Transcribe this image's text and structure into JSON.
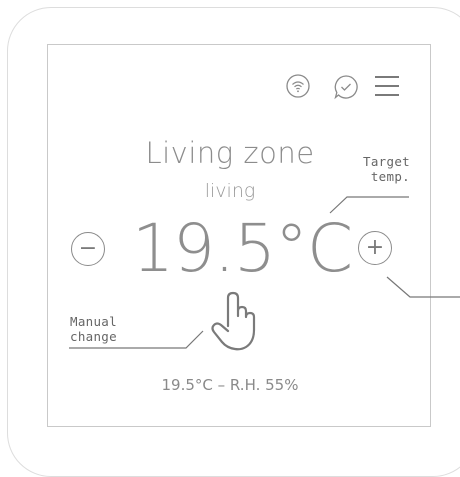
{
  "zone": {
    "title": "Living zone",
    "subtitle": "living",
    "temperature": "19.5°C",
    "status": "19.5°C – R.H. 55%"
  },
  "buttons": {
    "minus": "−",
    "plus": "+"
  },
  "annotations": {
    "target_line1": "Target",
    "target_line2": "temp.",
    "manual_line1": "Manual",
    "manual_line2": "change"
  },
  "icons": [
    "wifi-icon",
    "chat-check-icon",
    "menu-icon",
    "hand-pointer-icon"
  ],
  "colors": {
    "text": "#8a8a8a",
    "frame": "#c9c9c9",
    "annotation": "#666666"
  }
}
